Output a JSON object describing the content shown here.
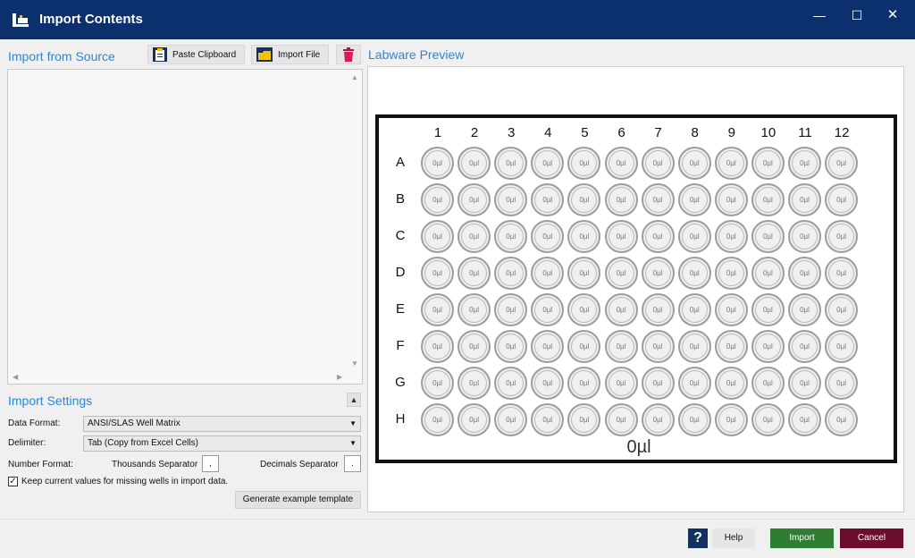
{
  "window": {
    "title": "Import Contents",
    "minimize_glyph": "—",
    "maximize_glyph": "☐",
    "close_glyph": "✕"
  },
  "source": {
    "title": "Import from Source",
    "paste_label": "Paste Clipboard",
    "import_file_label": "Import File",
    "paste_icon": "clipboard-icon",
    "import_icon": "folder-icon",
    "clear_icon": "trash-icon"
  },
  "settings": {
    "title": "Import Settings",
    "collapse_glyph": "▲",
    "data_format_label": "Data Format:",
    "data_format_value": "ANSI/SLAS Well Matrix",
    "delimiter_label": "Delimiter:",
    "delimiter_value": "Tab (Copy from Excel Cells)",
    "number_format_label": "Number Format:",
    "thousands_label": "Thousands Separator",
    "thousands_value": ",",
    "decimals_label": "Decimals Separator",
    "decimals_value": ".",
    "keep_values_label": "Keep current values for missing wells in import data.",
    "keep_values_checked": true,
    "generate_label": "Generate example template"
  },
  "preview": {
    "title": "Labware Preview",
    "columns": [
      "1",
      "2",
      "3",
      "4",
      "5",
      "6",
      "7",
      "8",
      "9",
      "10",
      "11",
      "12"
    ],
    "rows": [
      "A",
      "B",
      "C",
      "D",
      "E",
      "F",
      "G",
      "H"
    ],
    "well_value": "0µl",
    "total": "0µl"
  },
  "footer": {
    "help_label": "Help",
    "help_glyph": "?",
    "import_label": "Import",
    "cancel_label": "Cancel"
  },
  "colors": {
    "titlebar": "#0c2f6e",
    "accent": "#2b86d6",
    "import": "#2e7d32",
    "cancel": "#6b0e2d"
  }
}
